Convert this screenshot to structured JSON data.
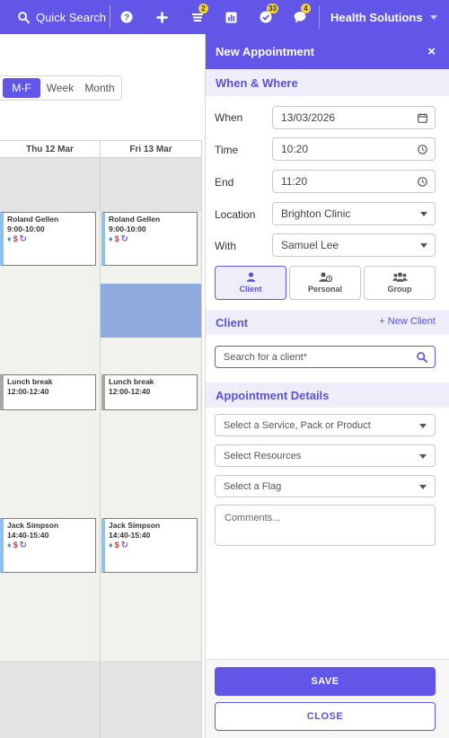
{
  "colors": {
    "accent": "#6156e8",
    "accent_light": "#eeeefb",
    "badge": "#f2d23c",
    "slot_gray": "#e3e3e3",
    "slot_light": "#f2f2ed",
    "slot_selected": "#8eaadf",
    "bell": "#3d8fe0",
    "dollar": "#d0343a",
    "recurring": "#7d5cd6"
  },
  "topbar": {
    "search_label": "Quick Search",
    "search_icon": "search-icon",
    "icons": [
      {
        "name": "help-icon",
        "badge": ""
      },
      {
        "name": "plus-icon",
        "badge": ""
      },
      {
        "name": "list-icon",
        "badge": "2"
      },
      {
        "name": "chart-icon",
        "badge": ""
      },
      {
        "name": "tasks-icon",
        "badge": "33"
      },
      {
        "name": "chat-icon",
        "badge": "4"
      }
    ],
    "brand": "Health Solutions"
  },
  "calendar": {
    "views": [
      "M-F",
      "Week",
      "Month"
    ],
    "active_view": "M-F",
    "columns": [
      "Thu 12 Mar",
      "Fri 13 Mar"
    ],
    "appointments": [
      {
        "title": "Roland Gellen",
        "time": "9:00-10:00",
        "type": "client"
      },
      {
        "title": "Roland Gellen",
        "time": "9:00-10:00",
        "type": "client"
      },
      {
        "title": "Lunch break",
        "time": "12:00-12:40",
        "type": "break"
      },
      {
        "title": "Lunch break",
        "time": "12:00-12:40",
        "type": "break"
      },
      {
        "title": "Jack Simpson",
        "time": "14:40-15:40",
        "type": "client"
      },
      {
        "title": "Jack Simpson",
        "time": "14:40-15:40",
        "type": "client"
      }
    ]
  },
  "panel": {
    "title": "New Appointment",
    "close_symbol": "×",
    "when_where": {
      "heading": "When & Where",
      "when_label": "When",
      "when_value": "13/03/2026",
      "time_label": "Time",
      "time_value": "10:20",
      "end_label": "End",
      "end_value": "11:20",
      "location_label": "Location",
      "location_value": "Brighton Clinic",
      "with_label": "With",
      "with_value": "Samuel Lee"
    },
    "types": [
      "Client",
      "Personal",
      "Group"
    ],
    "active_type": "Client",
    "client": {
      "heading": "Client",
      "new_client": "+ New Client",
      "search_placeholder": "Search for a client*"
    },
    "details": {
      "heading": "Appointment Details",
      "service": "Select a Service, Pack or Product",
      "resources": "Select Resources",
      "flag": "Select a Flag",
      "comments_placeholder": "Comments..."
    },
    "buttons": {
      "save": "SAVE",
      "close": "CLOSE"
    }
  }
}
